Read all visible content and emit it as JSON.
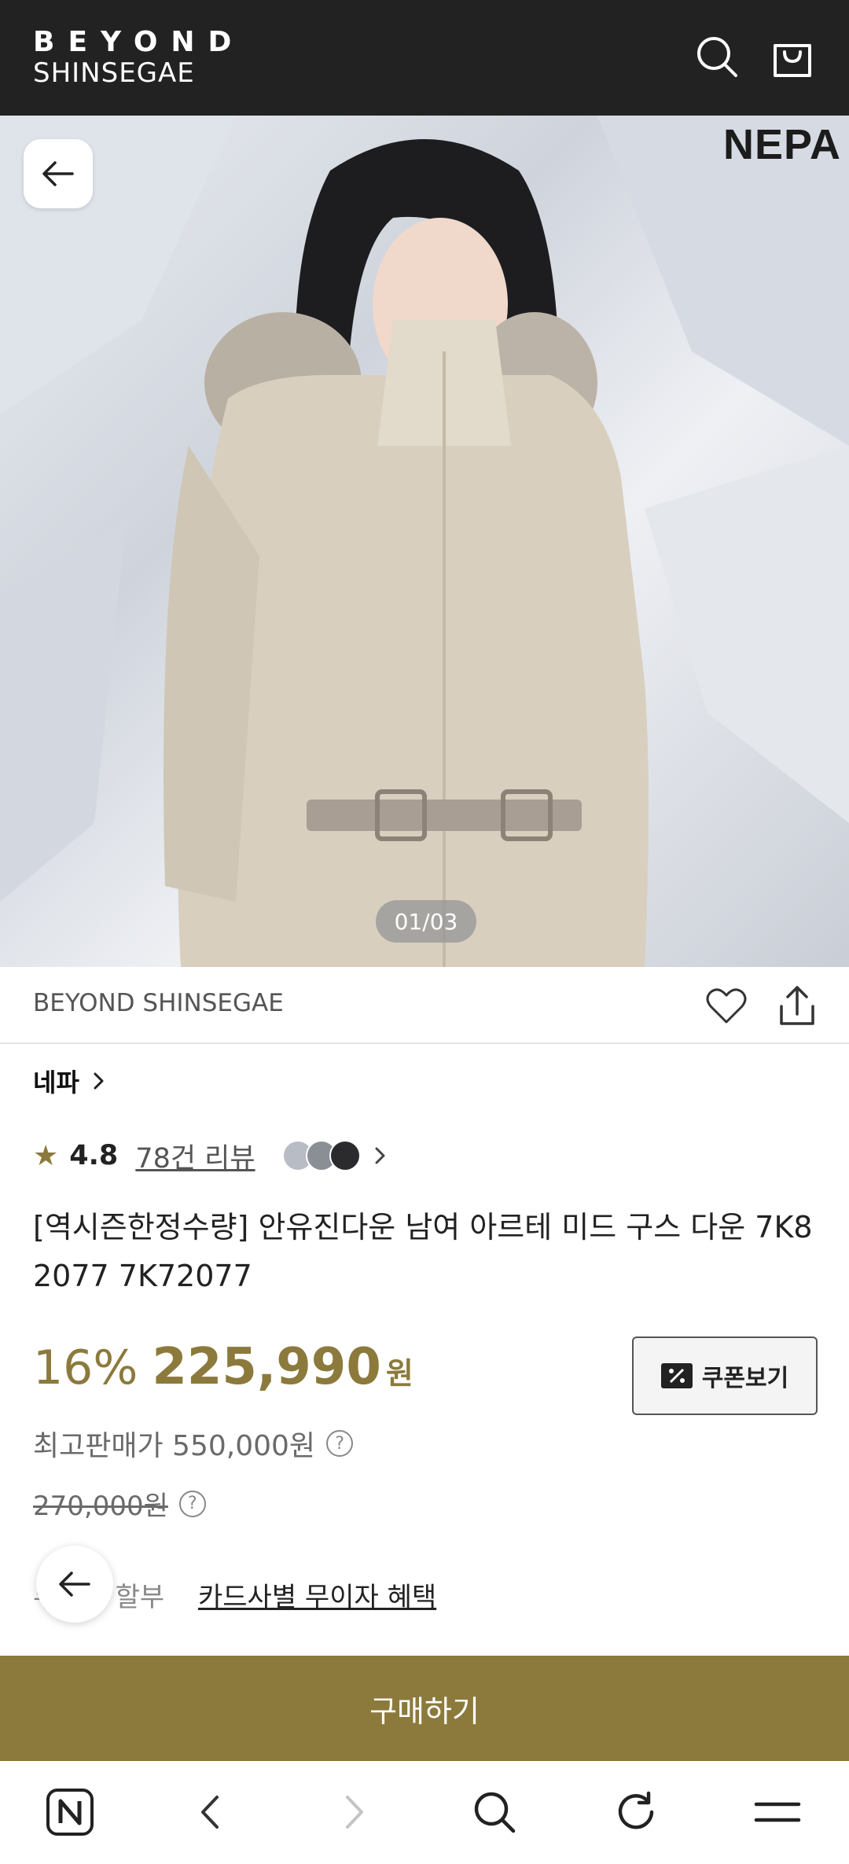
{
  "header": {
    "logo_line1": "BEYOND",
    "logo_line2": "SHINSEGAE",
    "search_icon": "search-icon",
    "cart_icon": "shopping-bag-icon"
  },
  "hero": {
    "brand_mark": "NEPA",
    "pager": "01/03",
    "back_icon": "arrow-left-icon"
  },
  "seller": {
    "name": "BEYOND SHINSEGAE",
    "wishlist_icon": "heart-icon",
    "share_icon": "share-icon"
  },
  "product": {
    "brand": "네파",
    "rating": "4.8",
    "review_count": "78건 리뷰",
    "title": "[역시즌한정수량] 안유진다운 남여 아르테 미드 구스 다운 7K8 2077 7K72077",
    "discount": "16%",
    "price": "225,990",
    "currency": "원",
    "coupon_label": "쿠폰보기",
    "max_price": "최고판매가 550,000원",
    "original_price": "270,000원",
    "installment": "무이자 할부",
    "card_benefit": "카드사별 무이자 혜택"
  },
  "actions": {
    "buy_label": "구매하기"
  },
  "colors": {
    "accent": "#8b7a3b",
    "header_bg": "#222222"
  },
  "browser_bar": {
    "icons": [
      "naver-home-icon",
      "back-arrow-icon",
      "forward-arrow-icon",
      "search-icon",
      "refresh-icon",
      "menu-icon"
    ]
  }
}
